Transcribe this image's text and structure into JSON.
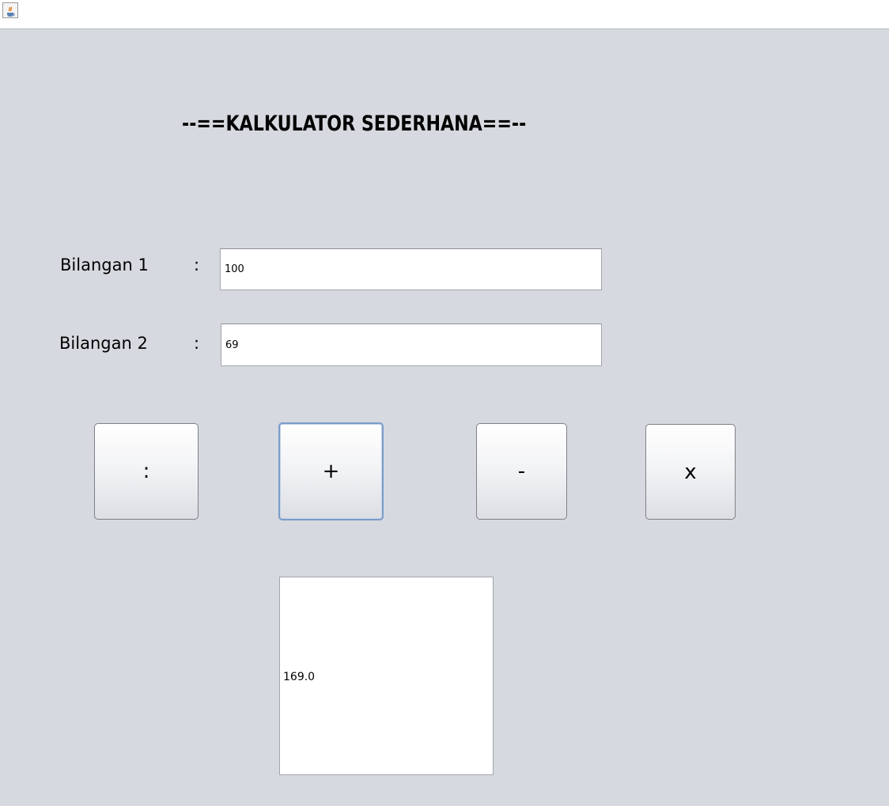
{
  "window": {
    "icon": "java-cup-icon"
  },
  "form": {
    "title": "--==KALKULATOR SEDERHANA==--",
    "bilangan1": {
      "label": "Bilangan 1",
      "colon": ":",
      "value": "100"
    },
    "bilangan2": {
      "label": "Bilangan 2",
      "colon": ":",
      "value": "69"
    }
  },
  "buttons": {
    "divide": ":",
    "add": "+",
    "subtract": "-",
    "multiply": "x"
  },
  "result": {
    "value": "169.0"
  },
  "colors": {
    "background": "#d6d9df",
    "focus_border": "#7a9cc8"
  }
}
